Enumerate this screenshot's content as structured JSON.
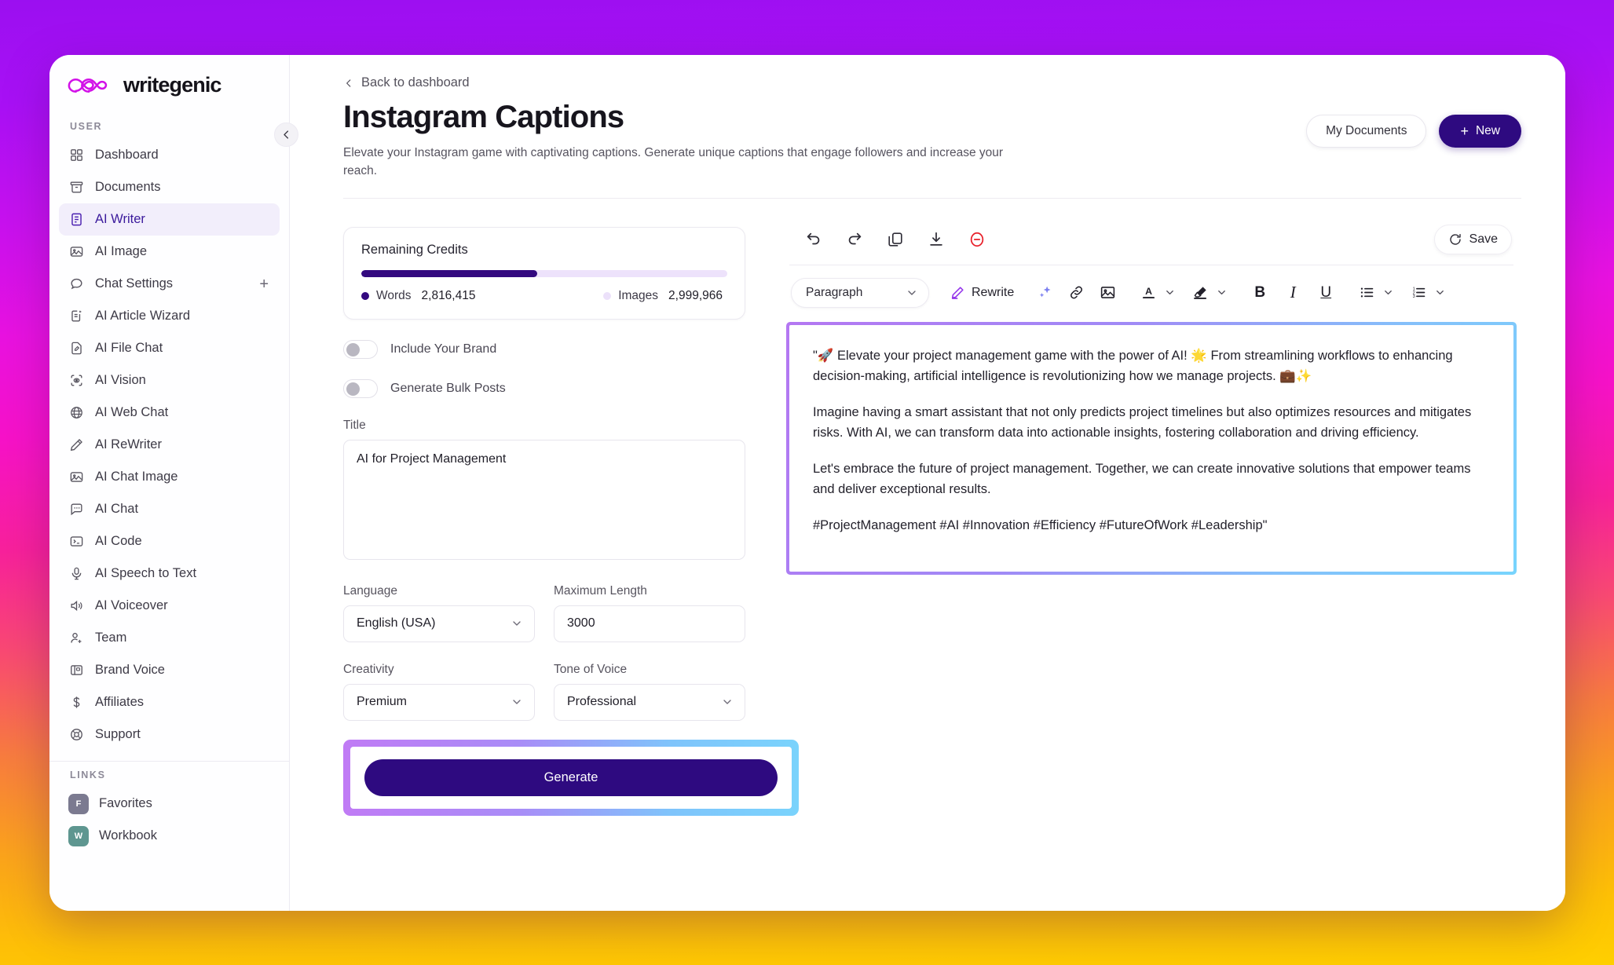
{
  "brand": {
    "name": "writegenic"
  },
  "sidebar": {
    "user_label": "USER",
    "links_label": "LINKS",
    "items": [
      {
        "label": "Dashboard",
        "icon": "grid-icon"
      },
      {
        "label": "Documents",
        "icon": "archive-icon"
      },
      {
        "label": "AI Writer",
        "icon": "document-text-icon",
        "active": true
      },
      {
        "label": "AI Image",
        "icon": "image-icon"
      },
      {
        "label": "Chat Settings",
        "icon": "chat-bubble-icon",
        "plus": "+"
      },
      {
        "label": "AI Article Wizard",
        "icon": "article-wizard-icon"
      },
      {
        "label": "AI File Chat",
        "icon": "file-pencil-icon"
      },
      {
        "label": "AI Vision",
        "icon": "vision-scan-icon"
      },
      {
        "label": "AI Web Chat",
        "icon": "globe-www-icon"
      },
      {
        "label": "AI ReWriter",
        "icon": "pencil-icon"
      },
      {
        "label": "AI Chat Image",
        "icon": "image-icon"
      },
      {
        "label": "AI Chat",
        "icon": "chat-dots-icon"
      },
      {
        "label": "AI Code",
        "icon": "terminal-icon"
      },
      {
        "label": "AI Speech to Text",
        "icon": "microphone-icon"
      },
      {
        "label": "AI Voiceover",
        "icon": "speaker-icon"
      },
      {
        "label": "Team",
        "icon": "user-plus-icon"
      },
      {
        "label": "Brand Voice",
        "icon": "brand-card-icon"
      },
      {
        "label": "Affiliates",
        "icon": "dollar-icon"
      },
      {
        "label": "Support",
        "icon": "lifebuoy-icon"
      }
    ],
    "links": [
      {
        "label": "Favorites",
        "badge": "F",
        "color": "#7b7a90"
      },
      {
        "label": "Workbook",
        "badge": "W",
        "color": "#5e9690"
      }
    ]
  },
  "header": {
    "back_label": "Back to dashboard",
    "title": "Instagram Captions",
    "subtitle": "Elevate your Instagram game with captivating captions. Generate unique captions that engage followers and increase your reach.",
    "my_documents_label": "My Documents",
    "new_label": "New",
    "new_plus": "+"
  },
  "credits": {
    "title": "Remaining Credits",
    "fill_percent": 48,
    "words_label": "Words",
    "words_value": "2,816,415",
    "images_label": "Images",
    "images_value": "2,999,966"
  },
  "form": {
    "toggle_brand_label": "Include Your Brand",
    "toggle_bulk_label": "Generate Bulk Posts",
    "title_label": "Title",
    "title_value": "AI for Project Management",
    "title_placeholder": "",
    "language_label": "Language",
    "language_value": "English (USA)",
    "max_length_label": "Maximum Length",
    "max_length_value": "3000",
    "creativity_label": "Creativity",
    "creativity_value": "Premium",
    "tone_label": "Tone of Voice",
    "tone_value": "Professional",
    "generate_label": "Generate"
  },
  "editor": {
    "toolbar_top": [
      {
        "name": "undo-icon"
      },
      {
        "name": "redo-icon"
      },
      {
        "name": "copy-icon"
      },
      {
        "name": "download-icon"
      },
      {
        "name": "delete-circle-icon"
      }
    ],
    "save_label": "Save",
    "paragraph_value": "Paragraph",
    "rewrite_label": "Rewrite",
    "bold_label": "B",
    "italic_label": "I",
    "underline_label": "U",
    "text_color_label": "A",
    "content": [
      "\"🚀 Elevate your project management game with the power of AI! 🌟 From streamlining workflows to enhancing decision-making, artificial intelligence is revolutionizing how we manage projects. 💼✨",
      "Imagine having a smart assistant that not only predicts project timelines but also optimizes resources and mitigates risks. With AI, we can transform data into actionable insights, fostering collaboration and driving efficiency.",
      "Let's embrace the future of project management. Together, we can create innovative solutions that empower teams and deliver exceptional results.",
      "#ProjectManagement #AI #Innovation #Efficiency #FutureOfWork #Leadership\""
    ]
  },
  "colors": {
    "accent": "#2e0a80",
    "brand_pink": "#d211e8",
    "highlight_start": "#c07bf5",
    "highlight_end": "#7ad3fc"
  }
}
